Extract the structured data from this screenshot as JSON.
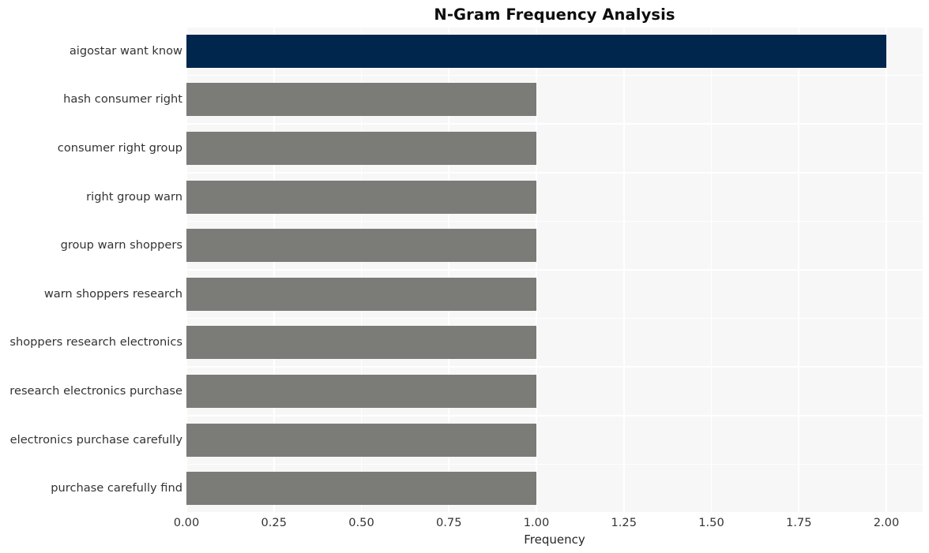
{
  "chart_data": {
    "type": "bar",
    "orientation": "horizontal",
    "title": "N-Gram Frequency Analysis",
    "xlabel": "Frequency",
    "ylabel": "",
    "categories": [
      "aigostar want know",
      "hash consumer right",
      "consumer right group",
      "right group warn",
      "group warn shoppers",
      "warn shoppers research",
      "shoppers research electronics",
      "research electronics purchase",
      "electronics purchase carefully",
      "purchase carefully find"
    ],
    "values": [
      2,
      1,
      1,
      1,
      1,
      1,
      1,
      1,
      1,
      1
    ],
    "bar_colors": [
      "#00264d",
      "#7b7b78",
      "#7b7b78",
      "#7b7b78",
      "#7b7b78",
      "#7b7b78",
      "#7b7b78",
      "#7b7b78",
      "#7b7b78",
      "#7b7b78"
    ],
    "xlim": [
      0,
      2.0
    ],
    "xticks": [
      0.0,
      0.25,
      0.5,
      0.75,
      1.0,
      1.25,
      1.5,
      1.75,
      2.0
    ],
    "xticklabels": [
      "0.00",
      "0.25",
      "0.50",
      "0.75",
      "1.00",
      "1.25",
      "1.50",
      "1.75",
      "2.00"
    ],
    "grid": true,
    "grid_color": "#ffffff",
    "plot_background": "#f7f7f7",
    "figure_background": "#ffffff",
    "legend": null,
    "highlight_color": "#00264d",
    "default_color": "#7b7b78"
  }
}
